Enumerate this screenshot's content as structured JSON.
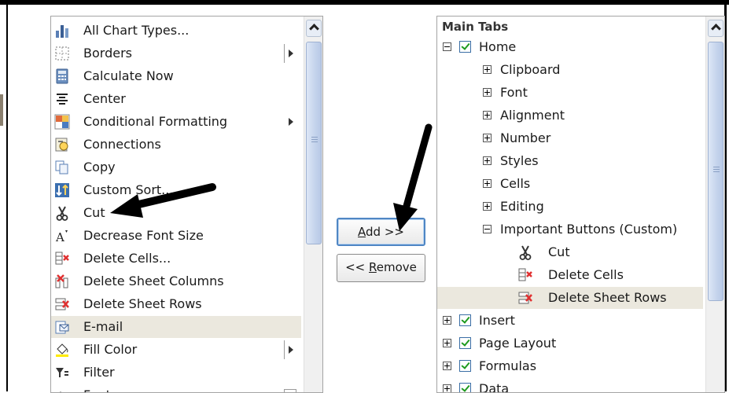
{
  "left_list": {
    "items": [
      {
        "label": "All Chart Types...",
        "icon": "chart-types-icon",
        "submenu": false
      },
      {
        "label": "Borders",
        "icon": "borders-icon",
        "submenu": true,
        "submenu_style": "separator"
      },
      {
        "label": "Calculate Now",
        "icon": "calculator-icon",
        "submenu": false
      },
      {
        "label": "Center",
        "icon": "align-center-icon",
        "submenu": false
      },
      {
        "label": "Conditional Formatting",
        "icon": "conditional-formatting-icon",
        "submenu": true
      },
      {
        "label": "Connections",
        "icon": "connections-icon",
        "submenu": false
      },
      {
        "label": "Copy",
        "icon": "copy-icon",
        "submenu": false
      },
      {
        "label": "Custom Sort...",
        "icon": "custom-sort-icon",
        "submenu": false
      },
      {
        "label": "Cut",
        "icon": "scissors-icon",
        "submenu": false
      },
      {
        "label": "Decrease Font Size",
        "icon": "decrease-font-icon",
        "submenu": false
      },
      {
        "label": "Delete Cells...",
        "icon": "delete-cells-icon",
        "submenu": false
      },
      {
        "label": "Delete Sheet Columns",
        "icon": "delete-columns-icon",
        "submenu": false
      },
      {
        "label": "Delete Sheet Rows",
        "icon": "delete-rows-icon",
        "submenu": false
      },
      {
        "label": "E-mail",
        "icon": "email-icon",
        "submenu": false,
        "selected": true
      },
      {
        "label": "Fill Color",
        "icon": "fill-color-icon",
        "submenu": true,
        "submenu_style": "separator"
      },
      {
        "label": "Filter",
        "icon": "filter-icon",
        "submenu": false
      },
      {
        "label": "Font",
        "icon": "font-icon",
        "submenu": true,
        "submenu_style": "box"
      }
    ]
  },
  "buttons": {
    "add_accel": "A",
    "add_rest": "dd >>",
    "remove_prefix": "<< ",
    "remove_accel": "R",
    "remove_rest": "emove"
  },
  "right_tree": {
    "header": "Main Tabs",
    "rows": [
      {
        "label": "Home",
        "level": 0,
        "expander": "minus",
        "checkbox": true
      },
      {
        "label": "Clipboard",
        "level": 1,
        "expander": "plus"
      },
      {
        "label": "Font",
        "level": 1,
        "expander": "plus"
      },
      {
        "label": "Alignment",
        "level": 1,
        "expander": "plus"
      },
      {
        "label": "Number",
        "level": 1,
        "expander": "plus"
      },
      {
        "label": "Styles",
        "level": 1,
        "expander": "plus"
      },
      {
        "label": "Cells",
        "level": 1,
        "expander": "plus"
      },
      {
        "label": "Editing",
        "level": 1,
        "expander": "plus"
      },
      {
        "label": "Important Buttons (Custom)",
        "level": 1,
        "expander": "minus"
      },
      {
        "label": "Cut",
        "level": 2,
        "icon": "scissors-icon"
      },
      {
        "label": "Delete Cells",
        "level": 2,
        "icon": "delete-cells-icon"
      },
      {
        "label": "Delete Sheet Rows",
        "level": 2,
        "icon": "delete-rows-icon",
        "selected": true
      },
      {
        "label": "Insert",
        "level": 0,
        "expander": "plus",
        "checkbox": true
      },
      {
        "label": "Page Layout",
        "level": 0,
        "expander": "plus",
        "checkbox": true
      },
      {
        "label": "Formulas",
        "level": 0,
        "expander": "plus",
        "checkbox": true
      },
      {
        "label": "Data",
        "level": 0,
        "expander": "plus",
        "checkbox": true
      }
    ]
  },
  "colors": {
    "selection": "#ebe8de",
    "checkbox_border": "#3a6ea5",
    "checkmark": "#1e9a1e",
    "scroll_thumb": "#c4d3ec"
  }
}
